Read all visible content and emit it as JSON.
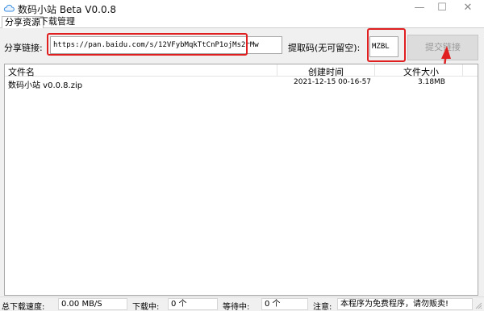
{
  "window": {
    "title": "数码小站 Beta V0.0.8",
    "icon": "cloud-icon",
    "controls": {
      "minimize": "—",
      "maximize": "☐",
      "close": "✕"
    }
  },
  "tabs": [
    {
      "label": "分享资源",
      "active": true
    },
    {
      "label": "下载管理",
      "active": false
    }
  ],
  "share": {
    "link_label": "分享链接:",
    "link_value": "https://pan.baidu.com/s/12VFybMqkTtCnP1ojMs2rMw",
    "code_label": "提取码(无可留空):",
    "code_value": "MZBL",
    "submit_label": "提交链接"
  },
  "file_list": {
    "columns": [
      "文件名",
      "创建时间",
      "文件大小"
    ],
    "rows": [
      {
        "name": "数码小站 v0.0.8.zip",
        "created": "2021-12-15 00-16-57",
        "size": "3.18MB"
      }
    ]
  },
  "status": {
    "speed_label": "总下载速度:",
    "speed_value": "0.00 MB/S",
    "downloading_label": "下载中:",
    "downloading_value": "0 个",
    "waiting_label": "等待中:",
    "waiting_value": "0 个",
    "notice_label": "注意:",
    "notice_value": "本程序为免费程序，请勿贩卖!"
  },
  "colors": {
    "highlight": "#e02020",
    "panel_bg": "#f0f0f0",
    "disabled_text": "#9a9a9a"
  }
}
